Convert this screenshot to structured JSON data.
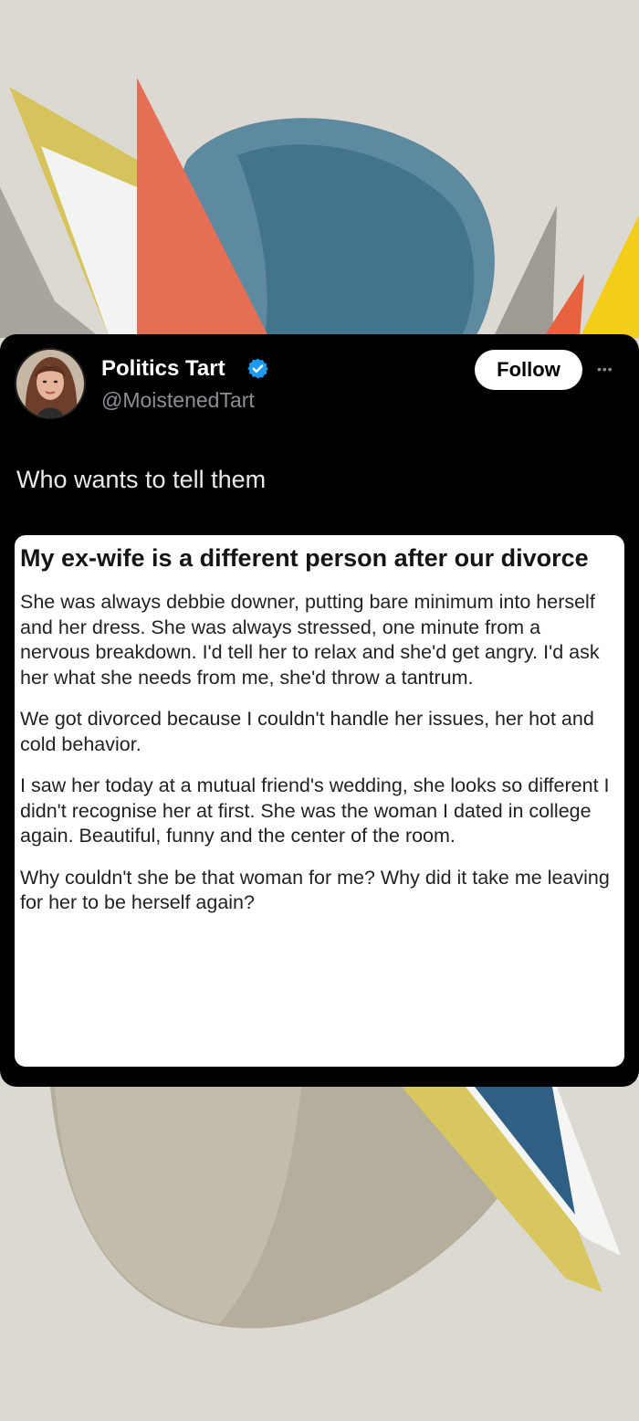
{
  "tweet": {
    "display_name": "Politics Tart",
    "handle": "@MoistenedTart",
    "follow_label": "Follow",
    "more_icon": "more-dots-icon",
    "verified_icon": "verified-badge-icon",
    "text": "Who wants to tell them"
  },
  "embedded_post": {
    "title": "My ex-wife is a different person after our divorce",
    "paragraphs": [
      "She was always debbie downer, putting bare minimum into herself and her dress. She was always stressed, one minute from a nervous breakdown. I'd tell her to relax and she'd get angry. I'd ask her what she needs from me, she'd throw a tantrum.",
      "We got divorced because I couldn't handle her issues, her hot and cold behavior.",
      "I saw her today at a mutual friend's wedding, she looks so different I didn't recognise her at first. She was the woman I dated in college again. Beautiful, funny and the center of the room.",
      "Why couldn't she be that woman for me? Why did it take me leaving for her to be herself again?"
    ]
  },
  "colors": {
    "card_background": "#000000",
    "verified_blue": "#1d9bf0",
    "handle_gray": "#8b8f94"
  }
}
